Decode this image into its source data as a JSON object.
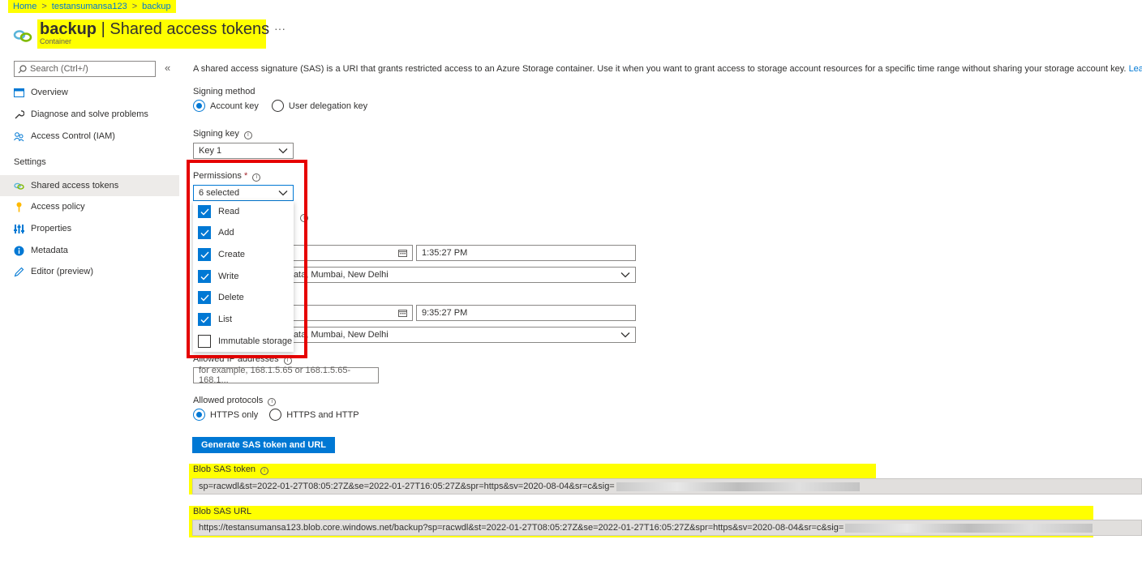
{
  "breadcrumb": {
    "home": "Home",
    "account": "testansumansa123",
    "container": "backup",
    "sep": ">"
  },
  "header": {
    "name": "backup",
    "divider": "|",
    "section": "Shared access tokens",
    "subtitle": "Container",
    "more": "···"
  },
  "sidebar": {
    "search_placeholder": "Search (Ctrl+/)",
    "collapse": "«",
    "items": [
      {
        "label": "Overview",
        "icon": "overview-icon"
      },
      {
        "label": "Diagnose and solve problems",
        "icon": "wrench-icon"
      },
      {
        "label": "Access Control (IAM)",
        "icon": "people-icon"
      }
    ],
    "settings_header": "Settings",
    "settings_items": [
      {
        "label": "Shared access tokens",
        "icon": "link-icon"
      },
      {
        "label": "Access policy",
        "icon": "key-icon"
      },
      {
        "label": "Properties",
        "icon": "properties-icon"
      },
      {
        "label": "Metadata",
        "icon": "info-icon"
      },
      {
        "label": "Editor (preview)",
        "icon": "pencil-icon"
      }
    ]
  },
  "main": {
    "description": "A shared access signature (SAS) is a URI that grants restricted access to an Azure Storage container. Use it when you want to grant access to storage account resources for a specific time range without sharing your storage account key.",
    "learn_more": "Learn more",
    "signing_method": {
      "label": "Signing method",
      "option1": "Account key",
      "option2": "User delegation key"
    },
    "signing_key": {
      "label": "Signing key",
      "value": "Key 1"
    },
    "permissions": {
      "label": "Permissions",
      "required": "*",
      "value": "6 selected",
      "options": [
        {
          "label": "Read",
          "checked": true
        },
        {
          "label": "Add",
          "checked": true
        },
        {
          "label": "Create",
          "checked": true
        },
        {
          "label": "Write",
          "checked": true
        },
        {
          "label": "Delete",
          "checked": true
        },
        {
          "label": "List",
          "checked": true
        },
        {
          "label": "Immutable storage",
          "checked": false
        }
      ]
    },
    "start_time": "1:35:27 PM",
    "start_timezone": "lkata, Mumbai, New Delhi",
    "expiry_time": "9:35:27 PM",
    "expiry_timezone": "lkata, Mumbai, New Delhi",
    "allowed_ip": {
      "label": "Allowed IP addresses",
      "placeholder": "for example, 168.1.5.65 or 168.1.5.65-168.1..."
    },
    "allowed_protocols": {
      "label": "Allowed protocols",
      "option1": "HTTPS only",
      "option2": "HTTPS and HTTP"
    },
    "generate_button": "Generate SAS token and URL",
    "blob_sas_token": {
      "label": "Blob SAS token",
      "value": "sp=racwdl&st=2022-01-27T08:05:27Z&se=2022-01-27T16:05:27Z&spr=https&sv=2020-08-04&sr=c&sig="
    },
    "blob_sas_url": {
      "label": "Blob SAS URL",
      "value": "https://testansumansa123.blob.core.windows.net/backup?sp=racwdl&st=2022-01-27T08:05:27Z&se=2022-01-27T16:05:27Z&spr=https&sv=2020-08-04&sr=c&sig="
    }
  },
  "colors": {
    "accent": "#0078d4",
    "highlight": "#ffff00",
    "annotation": "#e60000"
  }
}
